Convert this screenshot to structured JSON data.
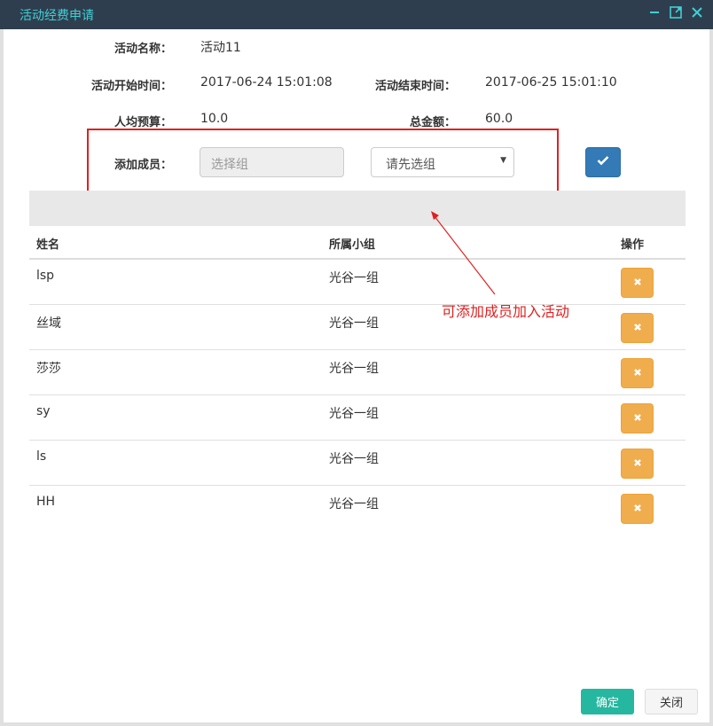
{
  "window": {
    "title": "活动经费申请"
  },
  "form": {
    "name_label": "活动名称：",
    "name_value": "活动11",
    "start_label": "活动开始时间：",
    "start_value": "2017-06-24 15:01:08",
    "end_label": "活动结束时间：",
    "end_value": "2017-06-25 15:01:10",
    "budget_label": "人均预算：",
    "budget_value": "10.0",
    "total_label": "总金额：",
    "total_value": "60.0",
    "add_member_label": "添加成员：",
    "group_select_value": "选择组",
    "member_select_value": "请先选组"
  },
  "table": {
    "headers": [
      "姓名",
      "所属小组",
      "操作"
    ],
    "rows": [
      {
        "name": "lsp",
        "group": "光谷一组"
      },
      {
        "name": "丝域",
        "group": "光谷一组"
      },
      {
        "name": "莎莎",
        "group": "光谷一组"
      },
      {
        "name": "sy",
        "group": "光谷一组"
      },
      {
        "name": "ls",
        "group": "光谷一组"
      },
      {
        "name": "HH",
        "group": "光谷一组"
      }
    ]
  },
  "annotation": {
    "text": "可添加成员加入活动"
  },
  "footer": {
    "ok_label": "确定",
    "close_label": "关闭"
  },
  "colors": {
    "titlebar_bg": "#2f3e4e",
    "title_text": "#3fd0d6",
    "primary_blue": "#337ab7",
    "warning_orange": "#f0ad4e",
    "ok_teal": "#26b7a0",
    "annotation_red": "#e02020"
  },
  "icons": {
    "titlebar": [
      "minimize-icon",
      "maximize-icon",
      "close-icon"
    ],
    "confirm": "check-icon",
    "delete": "times-icon",
    "dropdown": "caret-down-icon"
  }
}
